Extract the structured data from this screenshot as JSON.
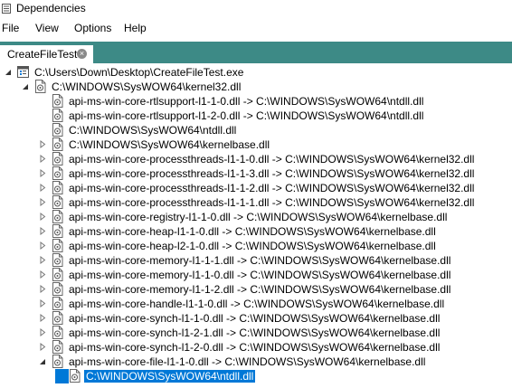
{
  "window": {
    "title": "Dependencies"
  },
  "menu": [
    {
      "label": "File"
    },
    {
      "label": "View"
    },
    {
      "label": "Options"
    },
    {
      "label": "Help"
    }
  ],
  "tab": {
    "label": "CreateFileTest",
    "close": "×"
  },
  "tree": [
    {
      "text": "C:\\Users\\Down\\Desktop\\CreateFileTest.exe",
      "level": 0,
      "arrow": "expanded",
      "icon": "exe-icon"
    },
    {
      "text": "C:\\WINDOWS\\SysWOW64\\kernel32.dll",
      "level": 1,
      "arrow": "expanded",
      "icon": "dll-icon"
    },
    {
      "text": "api-ms-win-core-rtlsupport-l1-1-0.dll -> C:\\WINDOWS\\SysWOW64\\ntdll.dll",
      "level": 2,
      "arrow": "none",
      "icon": "dll-icon"
    },
    {
      "text": "api-ms-win-core-rtlsupport-l1-2-0.dll -> C:\\WINDOWS\\SysWOW64\\ntdll.dll",
      "level": 2,
      "arrow": "none",
      "icon": "dll-icon"
    },
    {
      "text": "C:\\WINDOWS\\SysWOW64\\ntdll.dll",
      "level": 2,
      "arrow": "none",
      "icon": "dll-icon"
    },
    {
      "text": "C:\\WINDOWS\\SysWOW64\\kernelbase.dll",
      "level": 2,
      "arrow": "collapsed",
      "icon": "dll-icon"
    },
    {
      "text": "api-ms-win-core-processthreads-l1-1-0.dll -> C:\\WINDOWS\\SysWOW64\\kernel32.dll",
      "level": 2,
      "arrow": "collapsed",
      "icon": "dll-icon"
    },
    {
      "text": "api-ms-win-core-processthreads-l1-1-3.dll -> C:\\WINDOWS\\SysWOW64\\kernel32.dll",
      "level": 2,
      "arrow": "collapsed",
      "icon": "dll-icon"
    },
    {
      "text": "api-ms-win-core-processthreads-l1-1-2.dll -> C:\\WINDOWS\\SysWOW64\\kernel32.dll",
      "level": 2,
      "arrow": "collapsed",
      "icon": "dll-icon"
    },
    {
      "text": "api-ms-win-core-processthreads-l1-1-1.dll -> C:\\WINDOWS\\SysWOW64\\kernel32.dll",
      "level": 2,
      "arrow": "collapsed",
      "icon": "dll-icon"
    },
    {
      "text": "api-ms-win-core-registry-l1-1-0.dll -> C:\\WINDOWS\\SysWOW64\\kernelbase.dll",
      "level": 2,
      "arrow": "collapsed",
      "icon": "dll-icon"
    },
    {
      "text": "api-ms-win-core-heap-l1-1-0.dll -> C:\\WINDOWS\\SysWOW64\\kernelbase.dll",
      "level": 2,
      "arrow": "collapsed",
      "icon": "dll-icon"
    },
    {
      "text": "api-ms-win-core-heap-l2-1-0.dll -> C:\\WINDOWS\\SysWOW64\\kernelbase.dll",
      "level": 2,
      "arrow": "collapsed",
      "icon": "dll-icon"
    },
    {
      "text": "api-ms-win-core-memory-l1-1-1.dll -> C:\\WINDOWS\\SysWOW64\\kernelbase.dll",
      "level": 2,
      "arrow": "collapsed",
      "icon": "dll-icon"
    },
    {
      "text": "api-ms-win-core-memory-l1-1-0.dll -> C:\\WINDOWS\\SysWOW64\\kernelbase.dll",
      "level": 2,
      "arrow": "collapsed",
      "icon": "dll-icon"
    },
    {
      "text": "api-ms-win-core-memory-l1-1-2.dll -> C:\\WINDOWS\\SysWOW64\\kernelbase.dll",
      "level": 2,
      "arrow": "collapsed",
      "icon": "dll-icon"
    },
    {
      "text": "api-ms-win-core-handle-l1-1-0.dll -> C:\\WINDOWS\\SysWOW64\\kernelbase.dll",
      "level": 2,
      "arrow": "collapsed",
      "icon": "dll-icon"
    },
    {
      "text": "api-ms-win-core-synch-l1-1-0.dll -> C:\\WINDOWS\\SysWOW64\\kernelbase.dll",
      "level": 2,
      "arrow": "collapsed",
      "icon": "dll-icon"
    },
    {
      "text": "api-ms-win-core-synch-l1-2-1.dll -> C:\\WINDOWS\\SysWOW64\\kernelbase.dll",
      "level": 2,
      "arrow": "collapsed",
      "icon": "dll-icon"
    },
    {
      "text": "api-ms-win-core-synch-l1-2-0.dll -> C:\\WINDOWS\\SysWOW64\\kernelbase.dll",
      "level": 2,
      "arrow": "collapsed",
      "icon": "dll-icon"
    },
    {
      "text": "api-ms-win-core-file-l1-1-0.dll -> C:\\WINDOWS\\SysWOW64\\kernelbase.dll",
      "level": 2,
      "arrow": "expanded",
      "icon": "dll-icon"
    },
    {
      "text": "C:\\WINDOWS\\SysWOW64\\ntdll.dll",
      "level": 3,
      "arrow": "none",
      "icon": "dll-icon",
      "selected": true
    }
  ],
  "colors": {
    "tab_strip": "#3d8a86",
    "selection": "#0078d7"
  }
}
